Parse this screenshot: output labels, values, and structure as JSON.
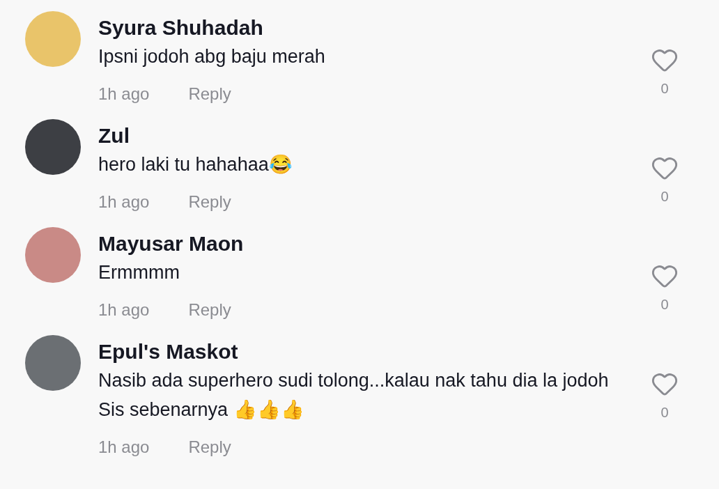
{
  "comments": [
    {
      "author": "Syura Shuhadah",
      "text": "Ipsni jodoh abg baju merah",
      "time": "1h ago",
      "reply": "Reply",
      "likes": "0"
    },
    {
      "author": "Zul",
      "text": "hero laki tu hahahaa😂",
      "time": "1h ago",
      "reply": "Reply",
      "likes": "0"
    },
    {
      "author": "Mayusar Maon",
      "text": "Ermmmm",
      "time": "1h ago",
      "reply": "Reply",
      "likes": "0"
    },
    {
      "author": "Epul's Maskot",
      "text": "Nasib ada superhero sudi tolong...kalau nak tahu dia la jodoh Sis sebenarnya 👍👍👍",
      "time": "1h ago",
      "reply": "Reply",
      "likes": "0"
    }
  ]
}
